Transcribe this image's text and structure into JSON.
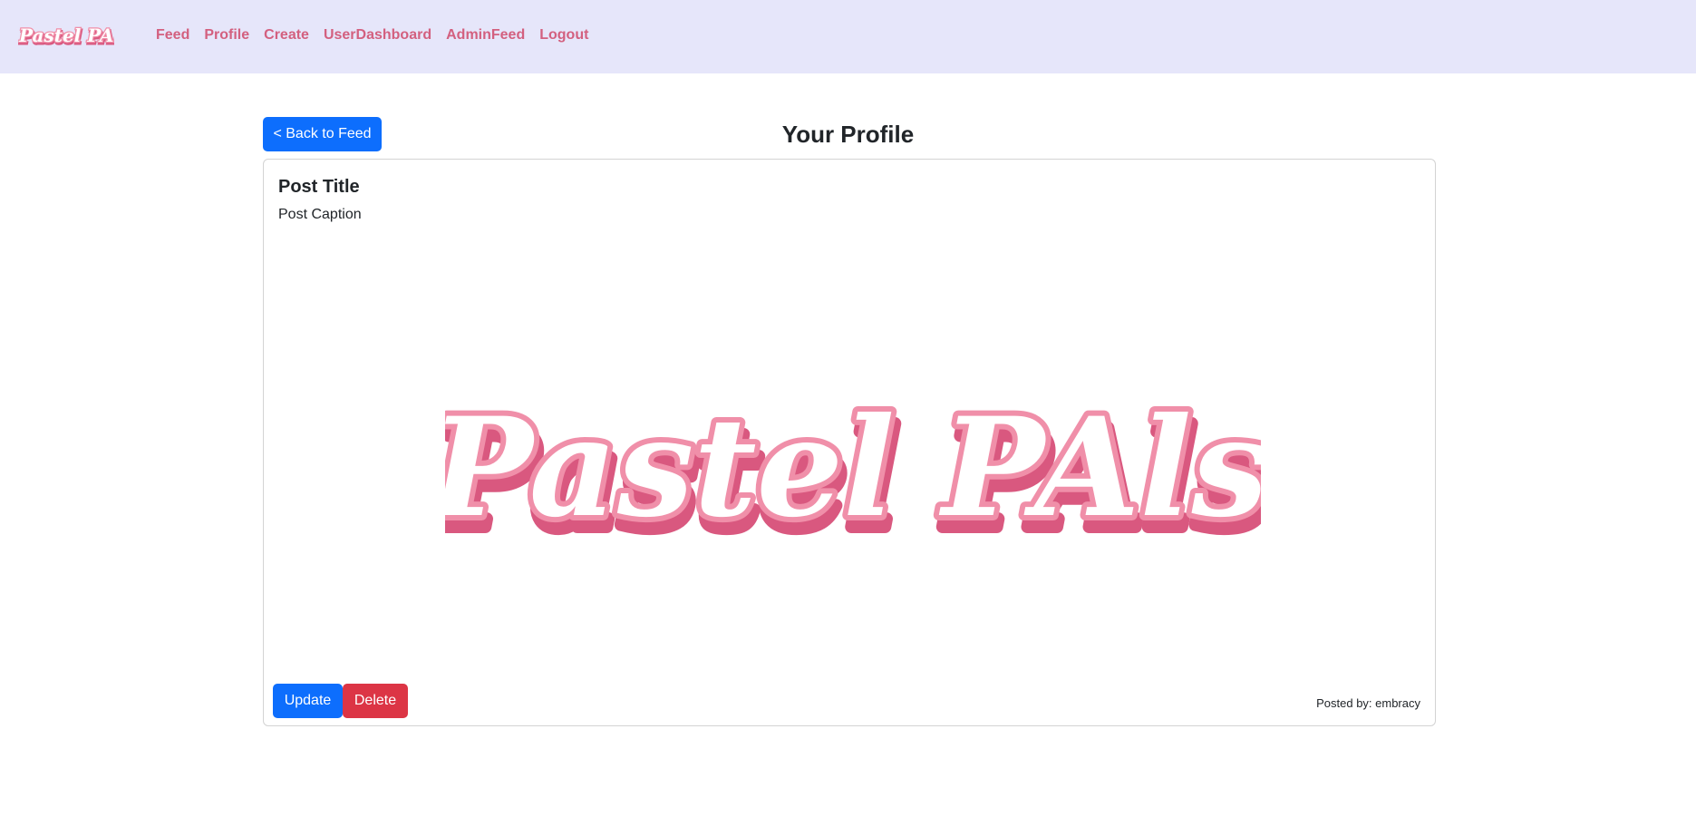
{
  "brand": {
    "name": "Pastel PAls"
  },
  "nav": {
    "items": [
      {
        "label": "Feed"
      },
      {
        "label": "Profile"
      },
      {
        "label": "Create"
      },
      {
        "label": "UserDashboard"
      },
      {
        "label": "AdminFeed"
      },
      {
        "label": "Logout"
      }
    ]
  },
  "page": {
    "back_label": "< Back to Feed",
    "title": "Your Profile"
  },
  "post": {
    "title": "Post Title",
    "caption": "Post Caption",
    "image_text": "Pastel PAls",
    "update_label": "Update",
    "delete_label": "Delete",
    "posted_by": "Posted by: embracy"
  },
  "colors": {
    "navbar_bg": "#e6e6fa",
    "nav_link": "#d3607f",
    "primary": "#0d6efd",
    "danger": "#dc3545",
    "logo_pink": "#f08fa9",
    "logo_shadow": "#d9587f"
  }
}
